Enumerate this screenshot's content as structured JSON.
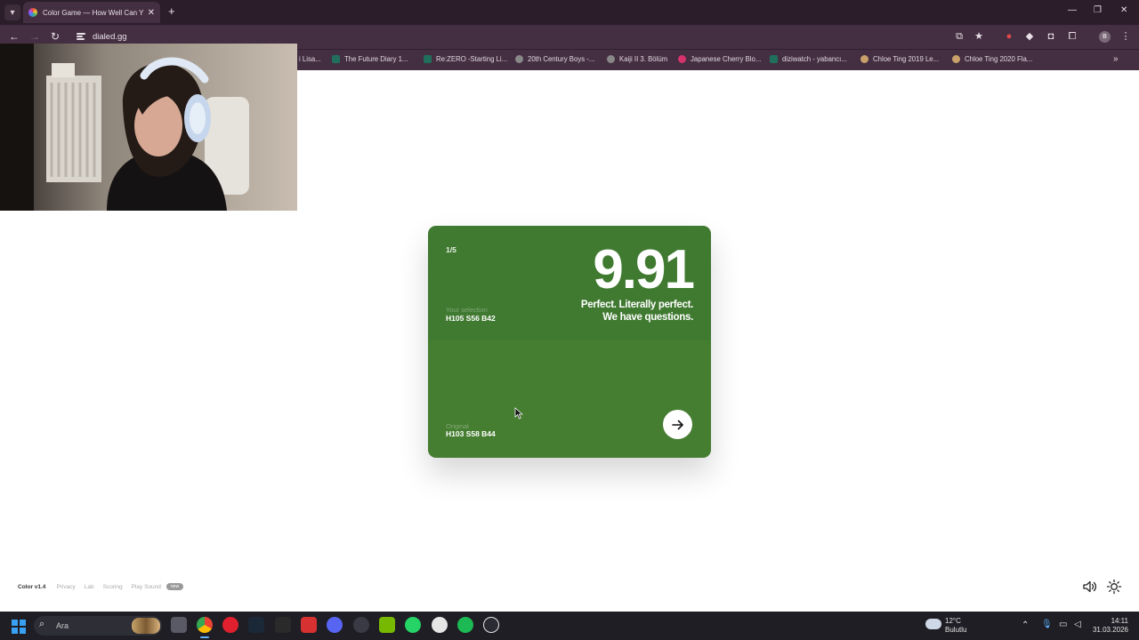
{
  "browser": {
    "tab_title": "Color Game — How Well Can Y",
    "url": "dialed.gg",
    "bookmarks": [
      {
        "label": "i Lisa...",
        "color": "#555555"
      },
      {
        "label": "The Future Diary 1...",
        "color": "#1f6f5c"
      },
      {
        "label": "Re:ZERO -Starting Li...",
        "color": "#1f6f5c"
      },
      {
        "label": "20th Century Boys -...",
        "color": "#888888"
      },
      {
        "label": "Kaiji II 3. Bölüm",
        "color": "#888888"
      },
      {
        "label": "Japanese Cherry Blo...",
        "color": "#d6336c"
      },
      {
        "label": "diziwatch - yabancı...",
        "color": "#1f6f5c"
      },
      {
        "label": "Chloe Ting 2019 Le...",
        "color": "#c9a06a"
      },
      {
        "label": "Chloe Ting 2020 Fla...",
        "color": "#c9a06a"
      }
    ],
    "profile_initial": "B"
  },
  "game": {
    "round": "1/5",
    "score": "9.91",
    "verdict_line1": "Perfect. Literally perfect.",
    "verdict_line2": "We have questions.",
    "selection_label": "Your selection",
    "selection_value": "H105 S56 B42",
    "original_label": "Original",
    "original_value": "H103 S58 B44",
    "selection_color": "#407a31",
    "original_color": "#457d31"
  },
  "footer": {
    "brand": "Color v1.4",
    "links": [
      "Privacy",
      "Lab",
      "Scoring",
      "Play Sound"
    ],
    "badge": "new"
  },
  "taskbar": {
    "search_placeholder": "Ara",
    "weather_temp": "12°C",
    "weather_desc": "Bulutlu",
    "time": "14:11",
    "date": "31.03.2026"
  }
}
